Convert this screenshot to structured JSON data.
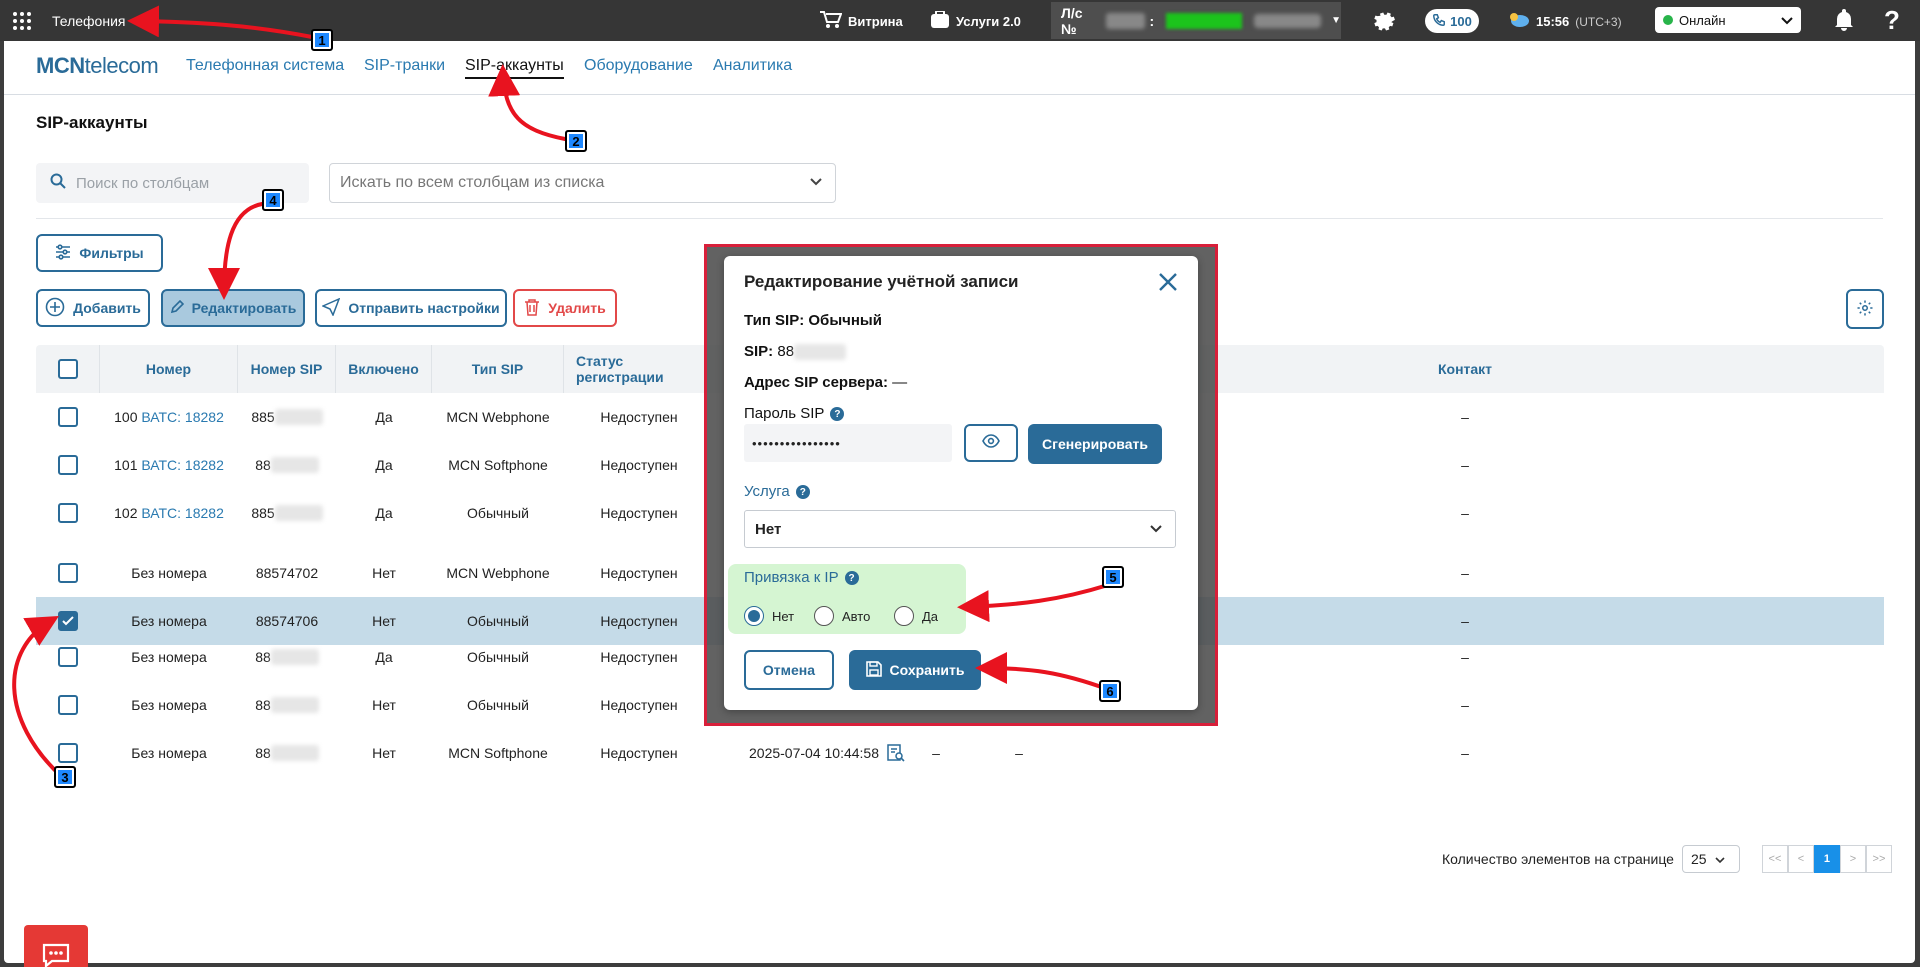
{
  "topbar": {
    "app_title": "Телефония",
    "showcase": "Витрина",
    "services": "Услуги 2.0",
    "account_prefix": "Л/с №",
    "account_sep": ":",
    "calls_count": "100",
    "time": "15:56",
    "timezone": "(UTC+3)",
    "status": "Онлайн",
    "help": "?"
  },
  "nav": {
    "logo_bold": "MCN",
    "logo_thin": "telecom",
    "items": [
      "Телефонная система",
      "SIP-транки",
      "SIP-аккаунты",
      "Оборудование",
      "Аналитика"
    ],
    "active_index": 2
  },
  "page": {
    "title": "SIP-аккаунты",
    "search_placeholder": "Поиск по столбцам",
    "search_all": "Искать по всем столбцам из списка",
    "filters": "Фильтры",
    "add": "Добавить",
    "edit": "Редактировать",
    "send_settings": "Отправить настройки",
    "delete": "Удалить"
  },
  "table": {
    "headers": [
      "Номер",
      "Номер SIP",
      "Включено",
      "Тип SIP",
      "Статус регистрации",
      "Контакт"
    ],
    "rows": [
      {
        "num": "100",
        "link": "ВАТС: 18282",
        "sip": "885",
        "on": "Да",
        "type": "MCN Webphone",
        "status": "Недоступен",
        "date": "",
        "contact": "–"
      },
      {
        "num": "101",
        "link": "ВАТС: 18282",
        "sip": "88",
        "on": "Да",
        "type": "MCN Softphone",
        "status": "Недоступен",
        "date": "",
        "contact": "–"
      },
      {
        "num": "102",
        "link": "ВАТС: 18282",
        "sip": "885",
        "on": "Да",
        "type": "Обычный",
        "status": "Недоступен",
        "date": "",
        "contact": "–"
      },
      {
        "num": "Без номера",
        "link": "",
        "sip": "88574702",
        "on": "Нет",
        "type": "MCN Webphone",
        "status": "Недоступен",
        "date": "",
        "contact": "–"
      },
      {
        "num": "Без номера",
        "link": "",
        "sip": "88574706",
        "on": "Нет",
        "type": "Обычный",
        "status": "Недоступен",
        "date": "",
        "contact": "–"
      },
      {
        "num": "Без номера",
        "link": "",
        "sip": "88",
        "on": "Да",
        "type": "Обычный",
        "status": "Недоступен",
        "date": "",
        "contact": "–"
      },
      {
        "num": "Без номера",
        "link": "",
        "sip": "88",
        "on": "Нет",
        "type": "Обычный",
        "status": "Недоступен",
        "date": "",
        "contact": "–"
      },
      {
        "num": "Без номера",
        "link": "",
        "sip": "88",
        "on": "Нет",
        "type": "MCN Softphone",
        "status": "Недоступен",
        "date": "2025-07-04 10:44:58",
        "contact": "–"
      }
    ],
    "extra_dashes": [
      "–",
      "–"
    ]
  },
  "pager": {
    "label": "Количество элементов на странице",
    "size": "25",
    "first": "<<",
    "prev": "<",
    "page": "1",
    "next": ">",
    "last": ">>"
  },
  "modal": {
    "title": "Редактирование учётной записи",
    "sip_type_label": "Тип SIP:",
    "sip_type_value": "Обычный",
    "sip_label": "SIP:",
    "sip_value": "88",
    "server_label": "Адрес SIP сервера:",
    "server_value": "—",
    "password_label": "Пароль SIP",
    "password_value": "••••••••••••••••",
    "generate": "Сгенерировать",
    "service_label": "Услуга",
    "service_value": "Нет",
    "ip_label": "Привязка к IP",
    "ip_options": [
      "Нет",
      "Авто",
      "Да"
    ],
    "ip_selected": "Нет",
    "cancel": "Отмена",
    "save": "Сохранить",
    "help_glyph": "?"
  },
  "annotations": [
    "1",
    "2",
    "3",
    "4",
    "5",
    "6"
  ],
  "colors": {
    "accent": "#2a6b98",
    "danger": "#e24848",
    "selected_row": "#c5dbe8",
    "highlight": "#d5f5d2",
    "arrow": "#e8131f"
  }
}
